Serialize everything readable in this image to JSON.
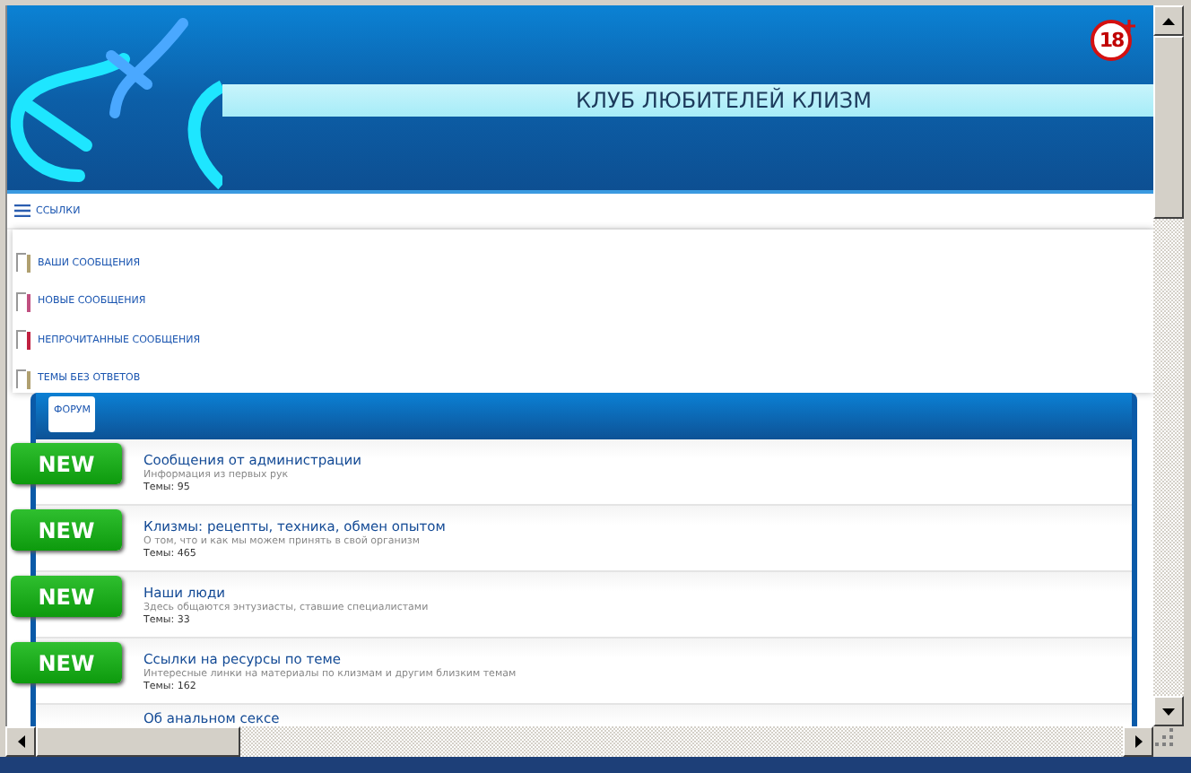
{
  "header": {
    "title": "КЛУБ ЛЮБИТЕЛЕЙ КЛИЗМ",
    "age_badge": "18"
  },
  "links_bar": {
    "label": "ССЫЛКИ"
  },
  "links_menu": {
    "items": [
      {
        "label": "ВАШИ СООБЩЕНИЯ",
        "color": "#b0a070"
      },
      {
        "label": "НОВЫЕ СООБЩЕНИЯ",
        "color": "#c05080"
      },
      {
        "label": "НЕПРОЧИТАННЫЕ СООБЩЕНИЯ",
        "color": "#c02040"
      },
      {
        "label": "ТЕМЫ БЕЗ ОТВЕТОВ",
        "color": "#b0a070"
      }
    ]
  },
  "forum_panel": {
    "tab": {
      "label": "ФОРУМ",
      "selected": true
    },
    "forums": [
      {
        "title": "Сообщения от администрации",
        "description": "Информация из первых рук",
        "topics": "Темы: 95",
        "badge": "NEW"
      },
      {
        "title": "Клизмы: рецепты, техника, обмен опытом",
        "description": "О том, что и как мы можем принять в свой организм",
        "topics": "Темы: 465",
        "badge": "NEW"
      },
      {
        "title": "Наши люди",
        "description": "Здесь общаются энтузиасты, ставшие специалистами",
        "topics": "Темы: 33",
        "badge": "NEW"
      },
      {
        "title": "Ссылки на ресурсы по теме",
        "description": "Интересные линки на материалы по клизмам и другим близким темам",
        "topics": "Темы: 162",
        "badge": "NEW"
      },
      {
        "title": "Об анальном сексе"
      }
    ]
  }
}
